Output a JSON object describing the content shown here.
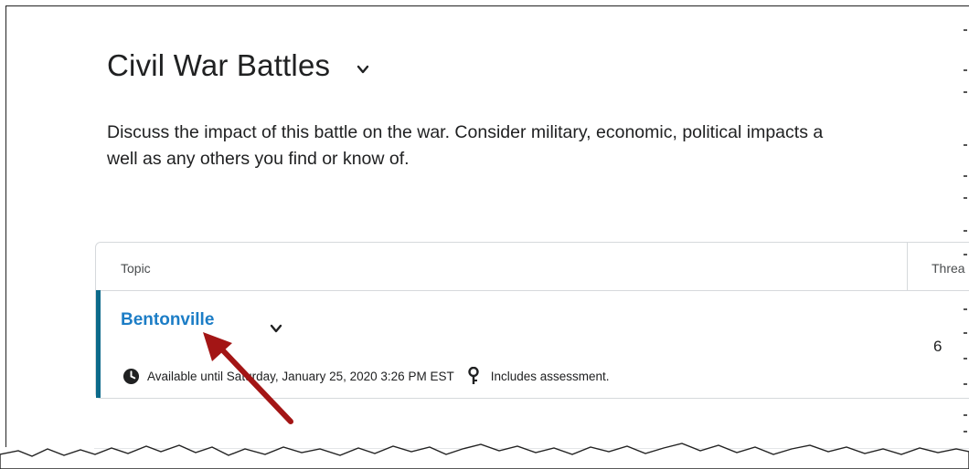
{
  "page": {
    "title": "Civil War Battles",
    "description_line1": "Discuss the impact of this battle on the war. Consider military, economic, political impacts a",
    "description_line2": "well as any others you find or know of."
  },
  "table": {
    "headers": {
      "topic": "Topic",
      "threads": "Threa"
    },
    "rows": [
      {
        "topic": "Bentonville",
        "availability": "Available until Saturday, January 25, 2020 3:26 PM EST",
        "assessment": "Includes assessment.",
        "threads": "6"
      }
    ]
  },
  "colors": {
    "link": "#1c7dc6",
    "row_accent": "#0b6a8a",
    "annotation_arrow": "#a31515"
  },
  "icons": [
    "chevron-down-icon",
    "clock-icon",
    "key-icon"
  ]
}
